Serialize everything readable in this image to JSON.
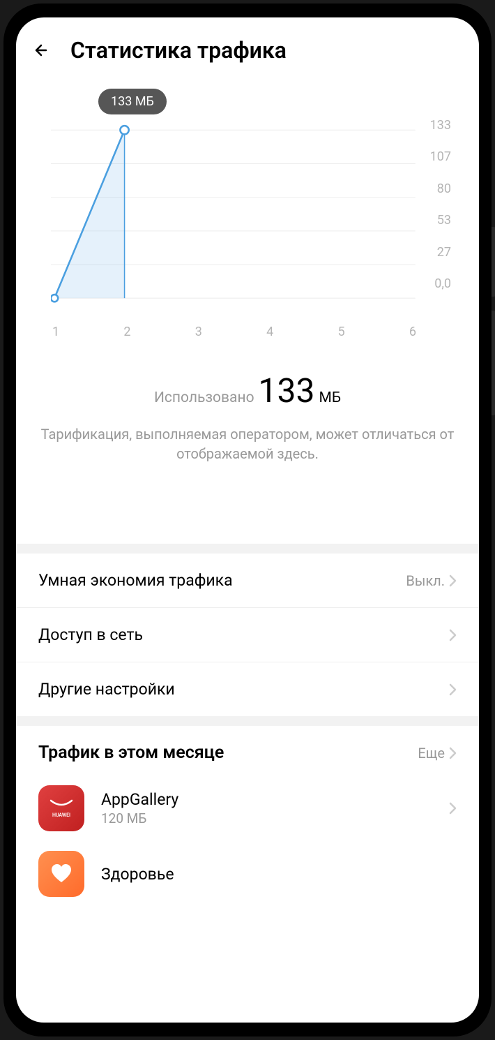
{
  "header": {
    "title": "Статистика трафика"
  },
  "chart_data": {
    "type": "line",
    "x": [
      1,
      2,
      3,
      4,
      5,
      6
    ],
    "values": [
      0,
      133,
      null,
      null,
      null,
      null
    ],
    "tooltip": "133 МБ",
    "ylim": [
      0,
      133
    ],
    "y_ticks": [
      "133",
      "107",
      "80",
      "53",
      "27",
      "0,0"
    ],
    "x_ticks": [
      "1",
      "2",
      "3",
      "4",
      "5",
      "6"
    ]
  },
  "usage": {
    "label": "Использовано",
    "value": "133",
    "unit": "МБ"
  },
  "disclaimer": "Тарификация, выполняемая оператором, может отличаться от отображаемой здесь.",
  "settings": [
    {
      "label": "Умная экономия трафика",
      "value": "Выкл."
    },
    {
      "label": "Доступ в сеть",
      "value": ""
    },
    {
      "label": "Другие настройки",
      "value": ""
    }
  ],
  "month_section": {
    "title": "Трафик в этом месяце",
    "more": "Еще"
  },
  "apps": [
    {
      "name": "AppGallery",
      "usage": "120 МБ",
      "icon": "appgallery"
    },
    {
      "name": "Здоровье",
      "usage": "",
      "icon": "health"
    }
  ]
}
